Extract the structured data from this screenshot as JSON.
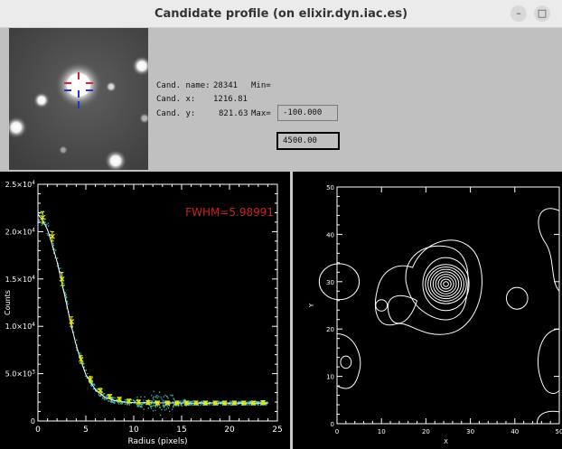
{
  "window": {
    "title": "Candidate profile (on elixir.dyn.iac.es)",
    "minimize_symbol": "–",
    "maximize_symbol": "□"
  },
  "candidate": {
    "name_label": "Cand. name:",
    "name_value": "28341",
    "x_label": "Cand. x:",
    "x_value": "1216.81",
    "y_label": "Cand. y:",
    "y_value": "821.63",
    "min_label": "Min=",
    "min_value": "-100.000",
    "max_label": "Max=",
    "max_value": "4500.00"
  },
  "chart_data": [
    {
      "type": "scatter",
      "title": "",
      "annotation": "FWHM=5.98991",
      "annotation_color": "#cc2222",
      "xlabel": "Radius (pixels)",
      "ylabel": "Counts",
      "xlim": [
        0,
        25
      ],
      "ylim": [
        0,
        25000
      ],
      "x_ticks": [
        0,
        5,
        10,
        15,
        20,
        25
      ],
      "y_ticks": [
        {
          "value": 0,
          "label": "0"
        },
        {
          "value": 5000,
          "label": "5.0×10",
          "exp": "3"
        },
        {
          "value": 10000,
          "label": "1.0×10",
          "exp": "4"
        },
        {
          "value": 15000,
          "label": "1.5×10",
          "exp": "4"
        },
        {
          "value": 20000,
          "label": "2.0×10",
          "exp": "4"
        },
        {
          "value": 25000,
          "label": "2.5×10",
          "exp": "4"
        }
      ],
      "series": [
        {
          "kind": "binned-points",
          "color": "#e8e800",
          "x": [
            0.5,
            1.5,
            2.5,
            3.5,
            4.5,
            5.5,
            6.5,
            7.5,
            8.5,
            9.5,
            10.5,
            11.5,
            12.5,
            13.5,
            14.5,
            15.5,
            16.5,
            17.5,
            18.5,
            19.5,
            20.5,
            21.5,
            22.5,
            23.5
          ],
          "y": [
            21500,
            19500,
            15000,
            10500,
            6500,
            4400,
            3200,
            2600,
            2300,
            2100,
            2000,
            1950,
            1900,
            1900,
            1900,
            1900,
            1900,
            1900,
            1900,
            1900,
            1900,
            1900,
            1900,
            1950
          ],
          "err": [
            600,
            500,
            700,
            500,
            400,
            300,
            250,
            200,
            200,
            200,
            200,
            200,
            200,
            200,
            200,
            200,
            200,
            200,
            200,
            200,
            200,
            200,
            200,
            200
          ]
        },
        {
          "kind": "fit",
          "color": "#ffffff",
          "x": [
            0,
            0.5,
            1,
            1.5,
            2,
            2.5,
            3,
            3.5,
            4,
            4.5,
            5,
            6,
            7,
            8,
            9,
            10,
            12,
            14,
            16,
            18,
            20,
            22,
            24
          ],
          "y": [
            21800,
            21200,
            20200,
            18600,
            16800,
            14600,
            12300,
            10000,
            8000,
            6300,
            4900,
            3300,
            2500,
            2150,
            2000,
            1950,
            1920,
            1910,
            1900,
            1900,
            1900,
            1900,
            1900
          ]
        }
      ]
    },
    {
      "type": "contour",
      "title": "",
      "xlabel": "X",
      "ylabel": "Y",
      "xlim": [
        0,
        50
      ],
      "ylim": [
        0,
        50
      ],
      "x_ticks": [
        0,
        10,
        20,
        30,
        40,
        50
      ],
      "y_ticks": [
        0,
        10,
        20,
        30,
        40,
        50
      ],
      "peak": {
        "x": 24.5,
        "y": 29.5
      },
      "levels": 8,
      "color": "#ffffff"
    }
  ]
}
